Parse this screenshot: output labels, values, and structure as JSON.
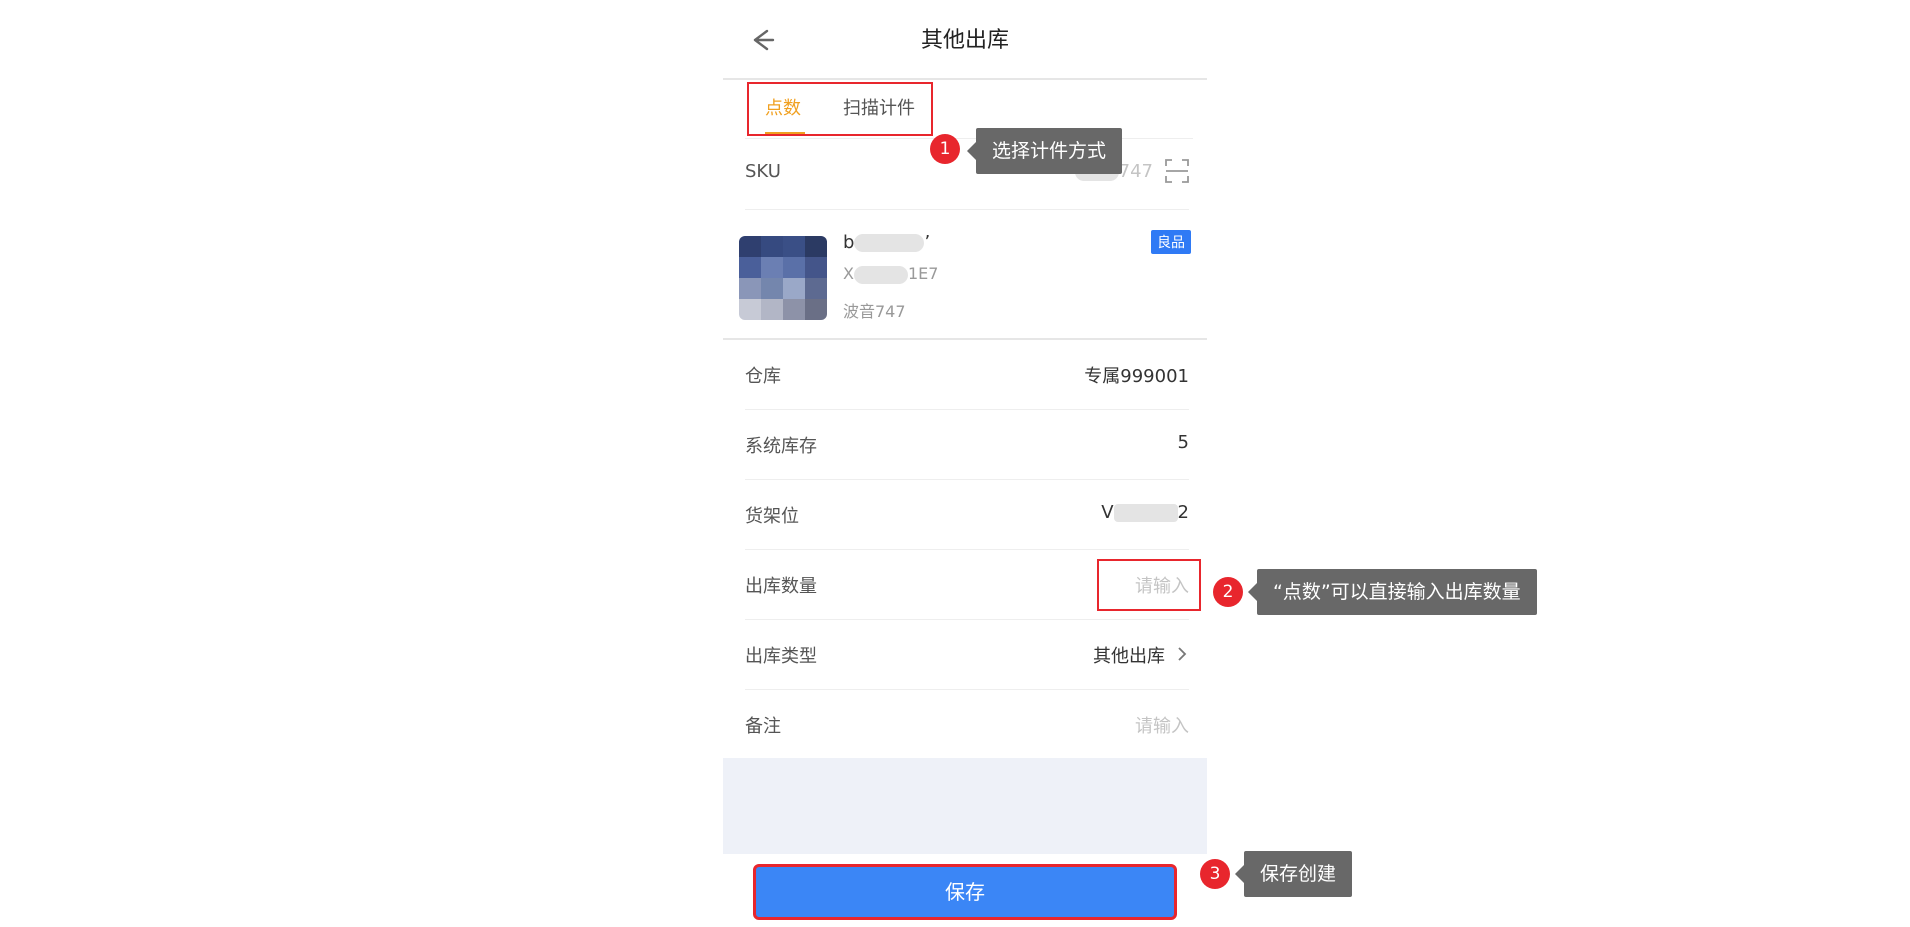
{
  "header": {
    "title": "其他出库",
    "back_icon": "arrow-left-icon"
  },
  "tabs": [
    {
      "label": "点数",
      "active": true
    },
    {
      "label": "扫描计件",
      "active": false
    }
  ],
  "sku": {
    "label": "SKU",
    "value_suffix": "747"
  },
  "product": {
    "name_prefix": "b",
    "name_suffix": "’",
    "code_prefix": "X",
    "code_suffix": "1E7",
    "model": "波音747",
    "badge": "良品"
  },
  "fields": {
    "warehouse": {
      "label": "仓库",
      "value": "专属999001"
    },
    "stock": {
      "label": "系统库存",
      "value": "5"
    },
    "shelf": {
      "label": "货架位",
      "value_prefix": "V",
      "value_suffix": "2"
    },
    "quantity": {
      "label": "出库数量",
      "placeholder": "请输入"
    },
    "type": {
      "label": "出库类型",
      "value": "其他出库"
    },
    "remark": {
      "label": "备注",
      "placeholder": "请输入"
    }
  },
  "save_button": {
    "label": "保存"
  },
  "annotations": [
    {
      "number": "1",
      "text": "选择计件方式"
    },
    {
      "number": "2",
      "text": "“点数”可以直接输入出库数量"
    },
    {
      "number": "3",
      "text": "保存创建"
    }
  ],
  "colors": {
    "accent": "#f0a020",
    "primary": "#3b86f6",
    "highlight": "#e8262d",
    "tooltip": "#686868",
    "badge": "#2f7af5"
  }
}
